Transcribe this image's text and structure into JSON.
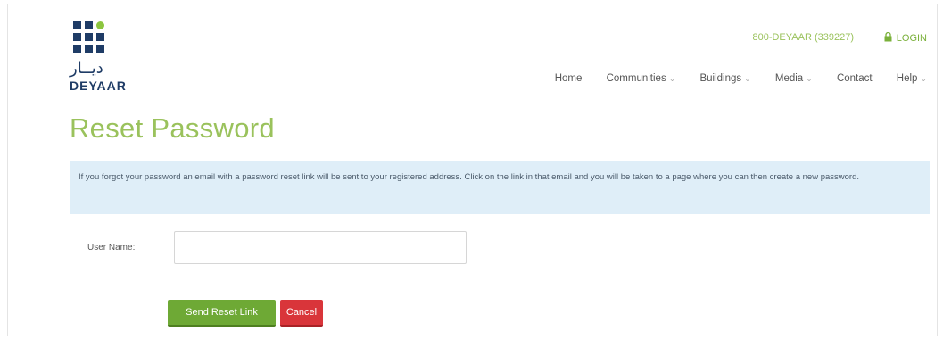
{
  "brand": {
    "arabic_name": "ديــار",
    "name": "DEYAAR",
    "logo_icon": "deyaar-grid-logo",
    "accent_green": "#9ac25c",
    "navy": "#1f3c66"
  },
  "utility": {
    "phone": "800-DEYAAR (339227)",
    "login_label": "LOGIN",
    "login_icon": "lock-icon"
  },
  "nav": {
    "items": [
      {
        "label": "Home",
        "has_dropdown": false
      },
      {
        "label": "Communities",
        "has_dropdown": true
      },
      {
        "label": "Buildings",
        "has_dropdown": true
      },
      {
        "label": "Media",
        "has_dropdown": true
      },
      {
        "label": "Contact",
        "has_dropdown": false
      },
      {
        "label": "Help",
        "has_dropdown": true
      }
    ]
  },
  "page": {
    "title": "Reset Password",
    "info_text": "If you forgot your password an email with a password reset link will be sent to your registered address. Click on the link in that email and you will be taken to a page where you can then create a new password."
  },
  "form": {
    "username_label": "User Name:",
    "username_value": "",
    "username_placeholder": "",
    "send_button": "Send Reset Link",
    "cancel_button": "Cancel"
  }
}
